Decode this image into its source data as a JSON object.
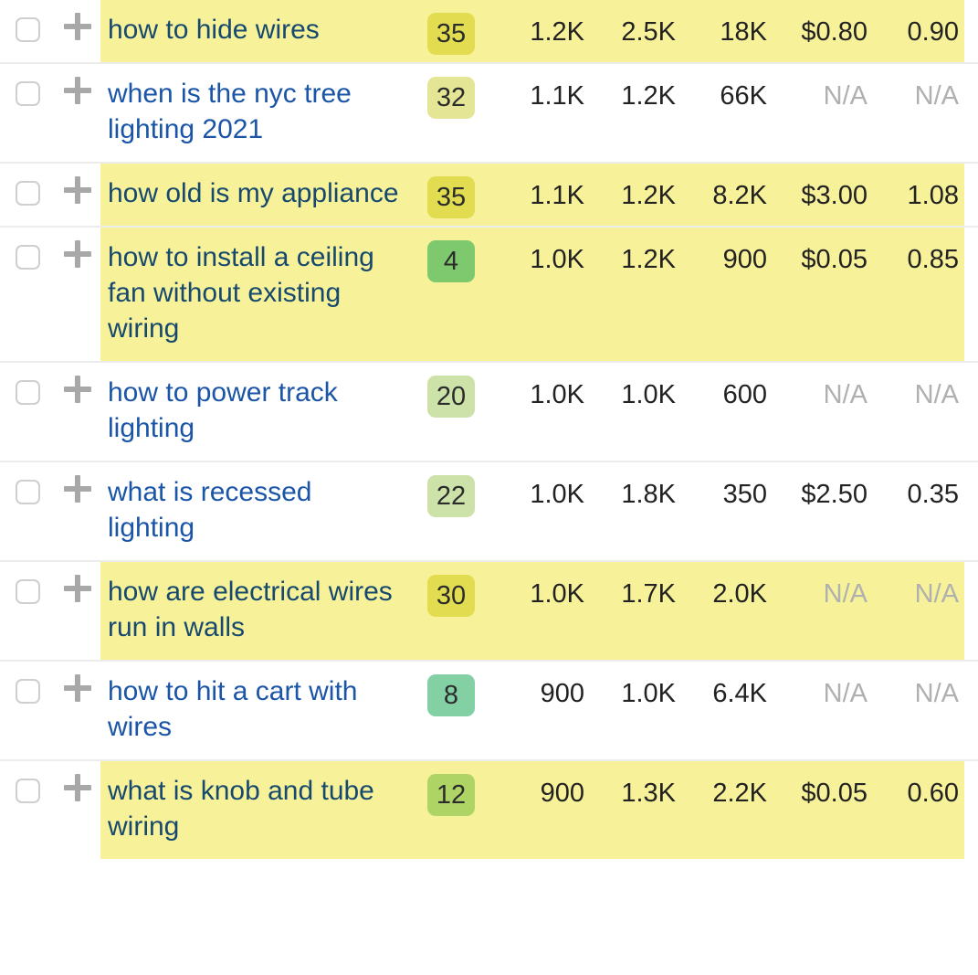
{
  "table": {
    "name": "keyword-ideas-table",
    "columns": [
      "checkbox",
      "add",
      "keyword",
      "kd",
      "volume",
      "global_volume",
      "traffic_potential",
      "cpc",
      "cps"
    ],
    "rows": [
      {
        "keyword": "how to hide wires",
        "kd": "35",
        "kd_color": "#e2dd50",
        "volume": "1.2K",
        "global_volume": "2.5K",
        "traffic_potential": "18K",
        "cpc": "$0.80",
        "cps": "0.90",
        "highlighted": true
      },
      {
        "keyword": "when is the nyc tree lighting 2021",
        "kd": "32",
        "kd_color": "#e4e595",
        "volume": "1.1K",
        "global_volume": "1.2K",
        "traffic_potential": "66K",
        "cpc": "N/A",
        "cps": "N/A",
        "highlighted": false
      },
      {
        "keyword": "how old is my appliance",
        "kd": "35",
        "kd_color": "#e2dd50",
        "volume": "1.1K",
        "global_volume": "1.2K",
        "traffic_potential": "8.2K",
        "cpc": "$3.00",
        "cps": "1.08",
        "highlighted": true
      },
      {
        "keyword": "how to install a ceiling fan without existing wiring",
        "kd": "4",
        "kd_color": "#7ec96e",
        "volume": "1.0K",
        "global_volume": "1.2K",
        "traffic_potential": "900",
        "cpc": "$0.05",
        "cps": "0.85",
        "highlighted": true
      },
      {
        "keyword": "how to power track lighting",
        "kd": "20",
        "kd_color": "#cde2a8",
        "volume": "1.0K",
        "global_volume": "1.0K",
        "traffic_potential": "600",
        "cpc": "N/A",
        "cps": "N/A",
        "highlighted": false
      },
      {
        "keyword": "what is recessed lighting",
        "kd": "22",
        "kd_color": "#cde2a8",
        "volume": "1.0K",
        "global_volume": "1.8K",
        "traffic_potential": "350",
        "cpc": "$2.50",
        "cps": "0.35",
        "highlighted": false
      },
      {
        "keyword": "how are electrical wires run in walls",
        "kd": "30",
        "kd_color": "#e2dd50",
        "volume": "1.0K",
        "global_volume": "1.7K",
        "traffic_potential": "2.0K",
        "cpc": "N/A",
        "cps": "N/A",
        "highlighted": true
      },
      {
        "keyword": "how to hit a cart with wires",
        "kd": "8",
        "kd_color": "#84d0a5",
        "volume": "900",
        "global_volume": "1.0K",
        "traffic_potential": "6.4K",
        "cpc": "N/A",
        "cps": "N/A",
        "highlighted": false
      },
      {
        "keyword": "what is knob and tube wiring",
        "kd": "12",
        "kd_color": "#aed466",
        "volume": "900",
        "global_volume": "1.3K",
        "traffic_potential": "2.2K",
        "cpc": "$0.05",
        "cps": "0.60",
        "highlighted": true
      }
    ]
  },
  "icons": {
    "add_keyword": "plus-icon",
    "select_row": "checkbox-icon"
  },
  "colors": {
    "link": "#1a55a8",
    "link_on_highlight": "#17496e",
    "row_highlight": "#f7f29a",
    "na_text": "#b0b0b0",
    "row_separator": "#ececec"
  }
}
